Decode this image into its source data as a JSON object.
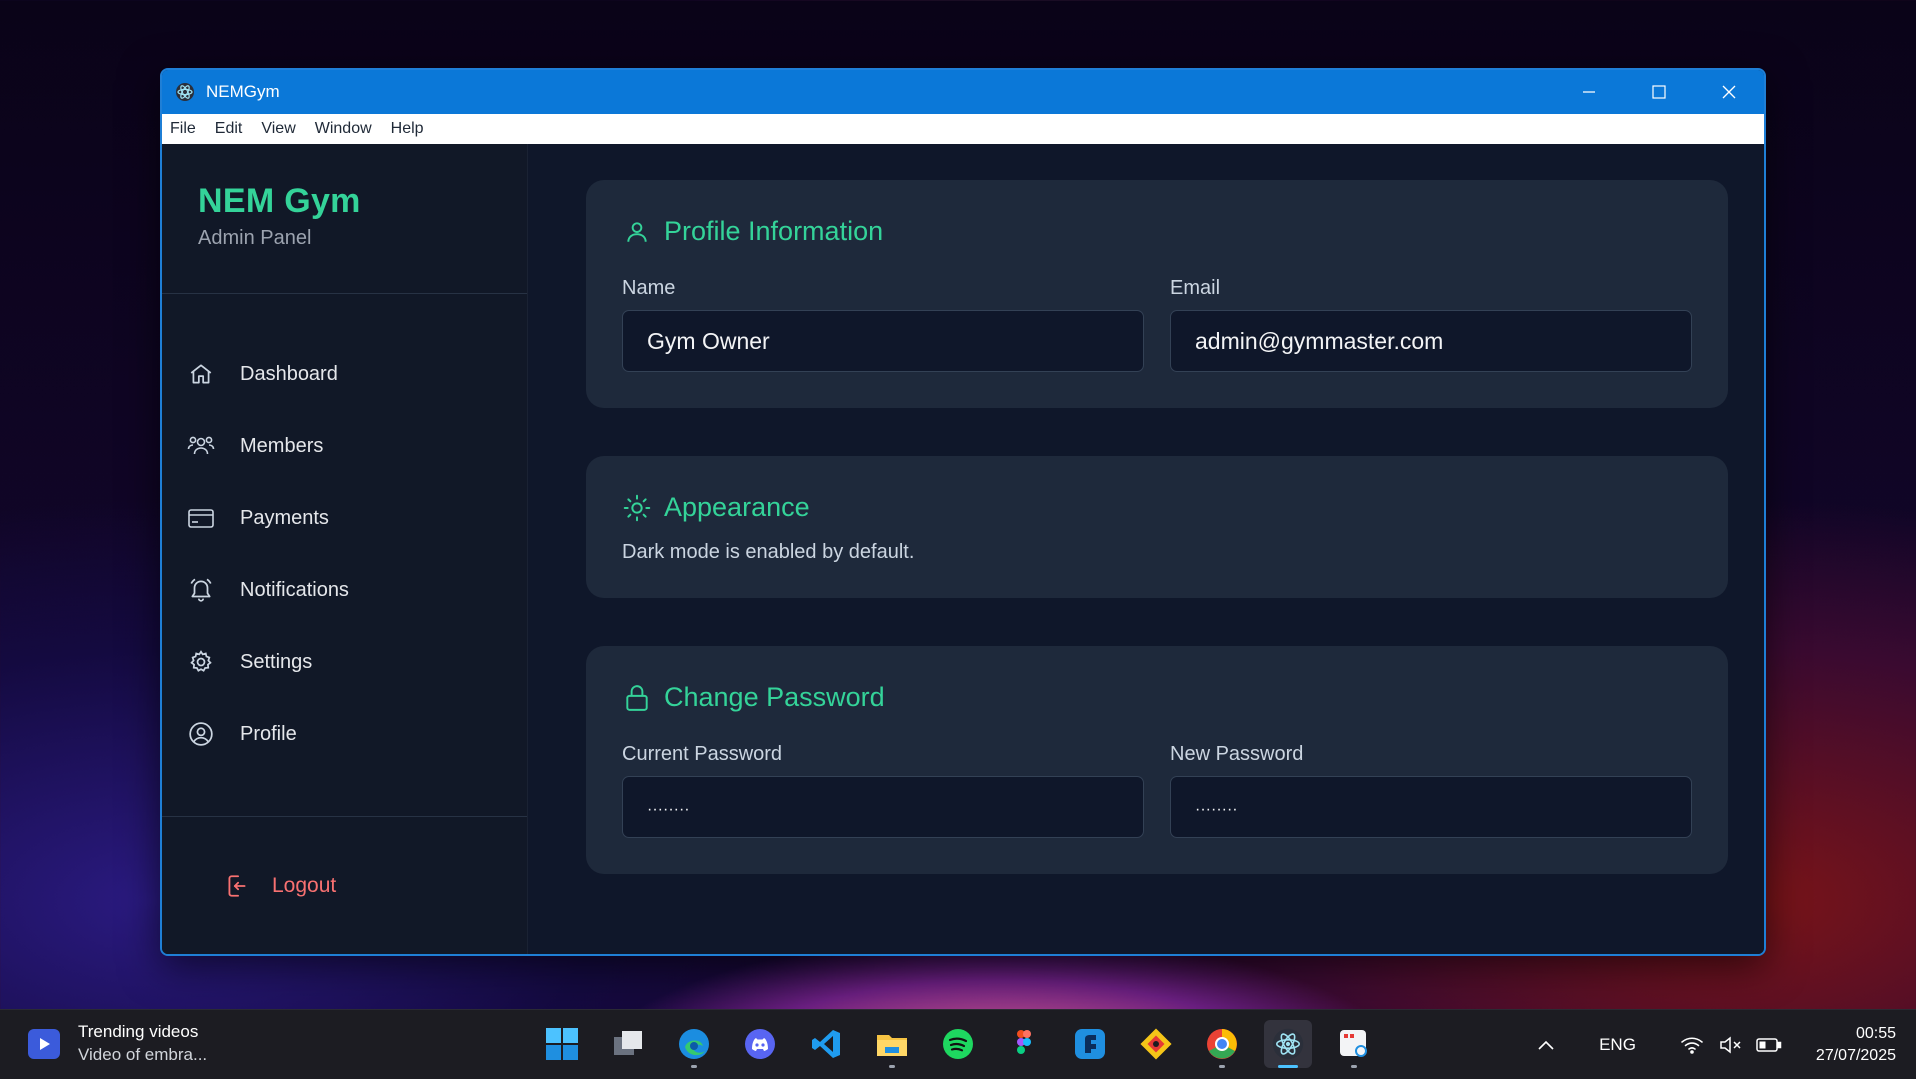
{
  "window": {
    "title": "NEMGym"
  },
  "menu": [
    "File",
    "Edit",
    "View",
    "Window",
    "Help"
  ],
  "sidebar": {
    "brand": "NEM Gym",
    "subtitle": "Admin Panel",
    "items": [
      {
        "label": "Dashboard",
        "icon": "home-icon"
      },
      {
        "label": "Members",
        "icon": "users-icon"
      },
      {
        "label": "Payments",
        "icon": "credit-card-icon"
      },
      {
        "label": "Notifications",
        "icon": "bell-icon"
      },
      {
        "label": "Settings",
        "icon": "gear-icon"
      },
      {
        "label": "Profile",
        "icon": "user-circle-icon"
      }
    ],
    "logout": "Logout"
  },
  "profile": {
    "title": "Profile Information",
    "name_label": "Name",
    "name_value": "Gym Owner",
    "email_label": "Email",
    "email_value": "admin@gymmaster.com"
  },
  "appearance": {
    "title": "Appearance",
    "text": "Dark mode is enabled by default."
  },
  "password": {
    "title": "Change Password",
    "current_label": "Current Password",
    "current_value": "········",
    "new_label": "New Password",
    "new_value": "········"
  },
  "taskbar": {
    "widget_line1": "Trending videos",
    "widget_line2": "Video of embra...",
    "language": "ENG",
    "time": "00:55",
    "date": "27/07/2025"
  },
  "colors": {
    "accent": "#34d399",
    "danger": "#f87171",
    "titlebar": "#0b78d8"
  }
}
